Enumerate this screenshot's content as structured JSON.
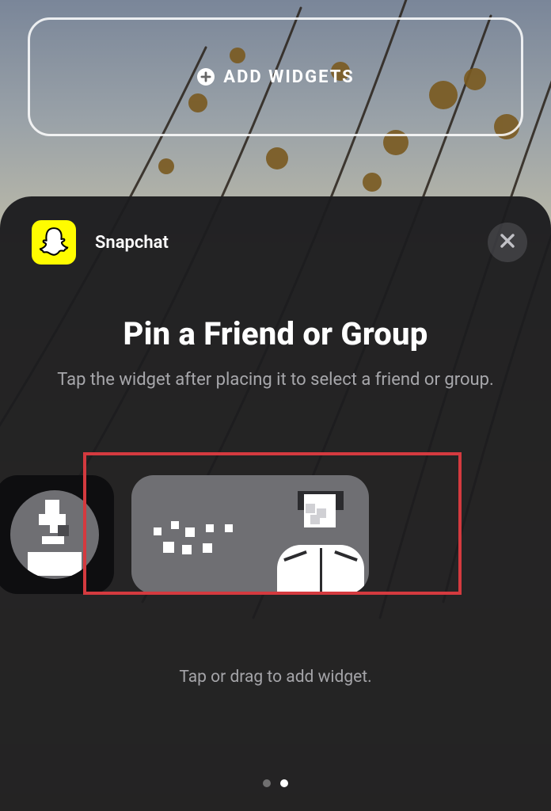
{
  "lockscreen": {
    "add_widgets_label": "ADD WIDGETS"
  },
  "sheet": {
    "app_name": "Snapchat",
    "title": "Pin a Friend or Group",
    "subtitle": "Tap the widget after placing it to select a friend or group.",
    "hint": "Tap or drag to add widget.",
    "page_index": 1,
    "page_count": 2
  },
  "colors": {
    "snapchat_yellow": "#FFFC00",
    "highlight_red": "#d43a3f"
  }
}
